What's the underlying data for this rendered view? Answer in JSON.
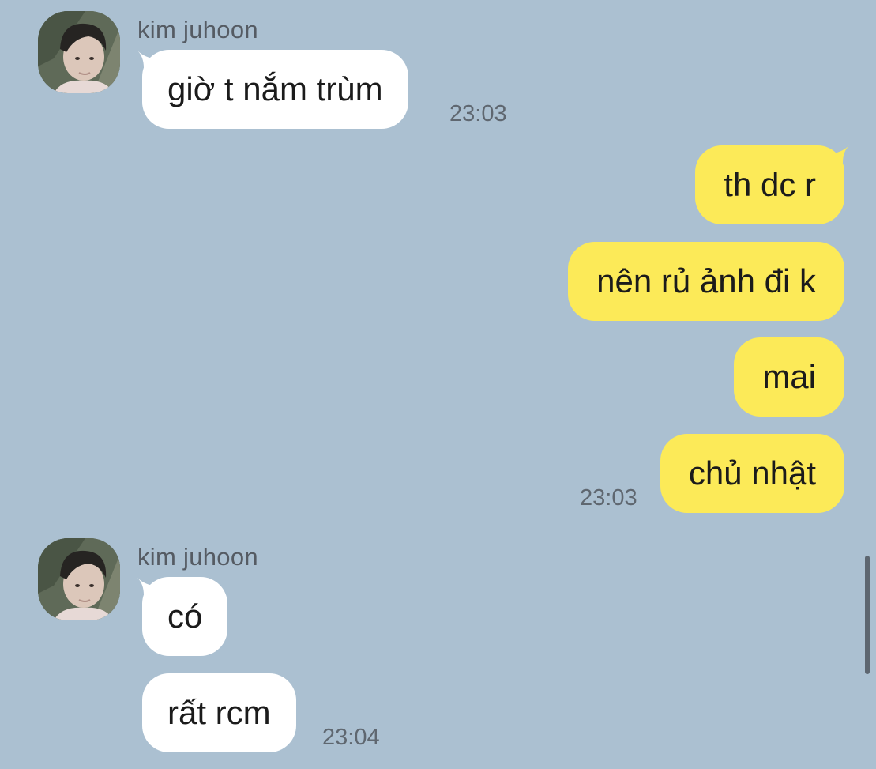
{
  "colors": {
    "background": "#abc0d1",
    "incoming_bubble": "#ffffff",
    "outgoing_bubble": "#fcea58",
    "name_text": "#555b63",
    "time_text": "#5f6770"
  },
  "messages": {
    "group1": {
      "sender": "kim juhoon",
      "avatar_icon": "profile-photo",
      "items": [
        "giờ t nắm trùm"
      ],
      "time": "23:03"
    },
    "group2": {
      "items": [
        "th dc r",
        "nên rủ ảnh đi k",
        "mai",
        "chủ nhật"
      ],
      "time": "23:03"
    },
    "group3": {
      "sender": "kim juhoon",
      "avatar_icon": "profile-photo",
      "items": [
        "có",
        "rất rcm"
      ],
      "time": "23:04"
    }
  }
}
